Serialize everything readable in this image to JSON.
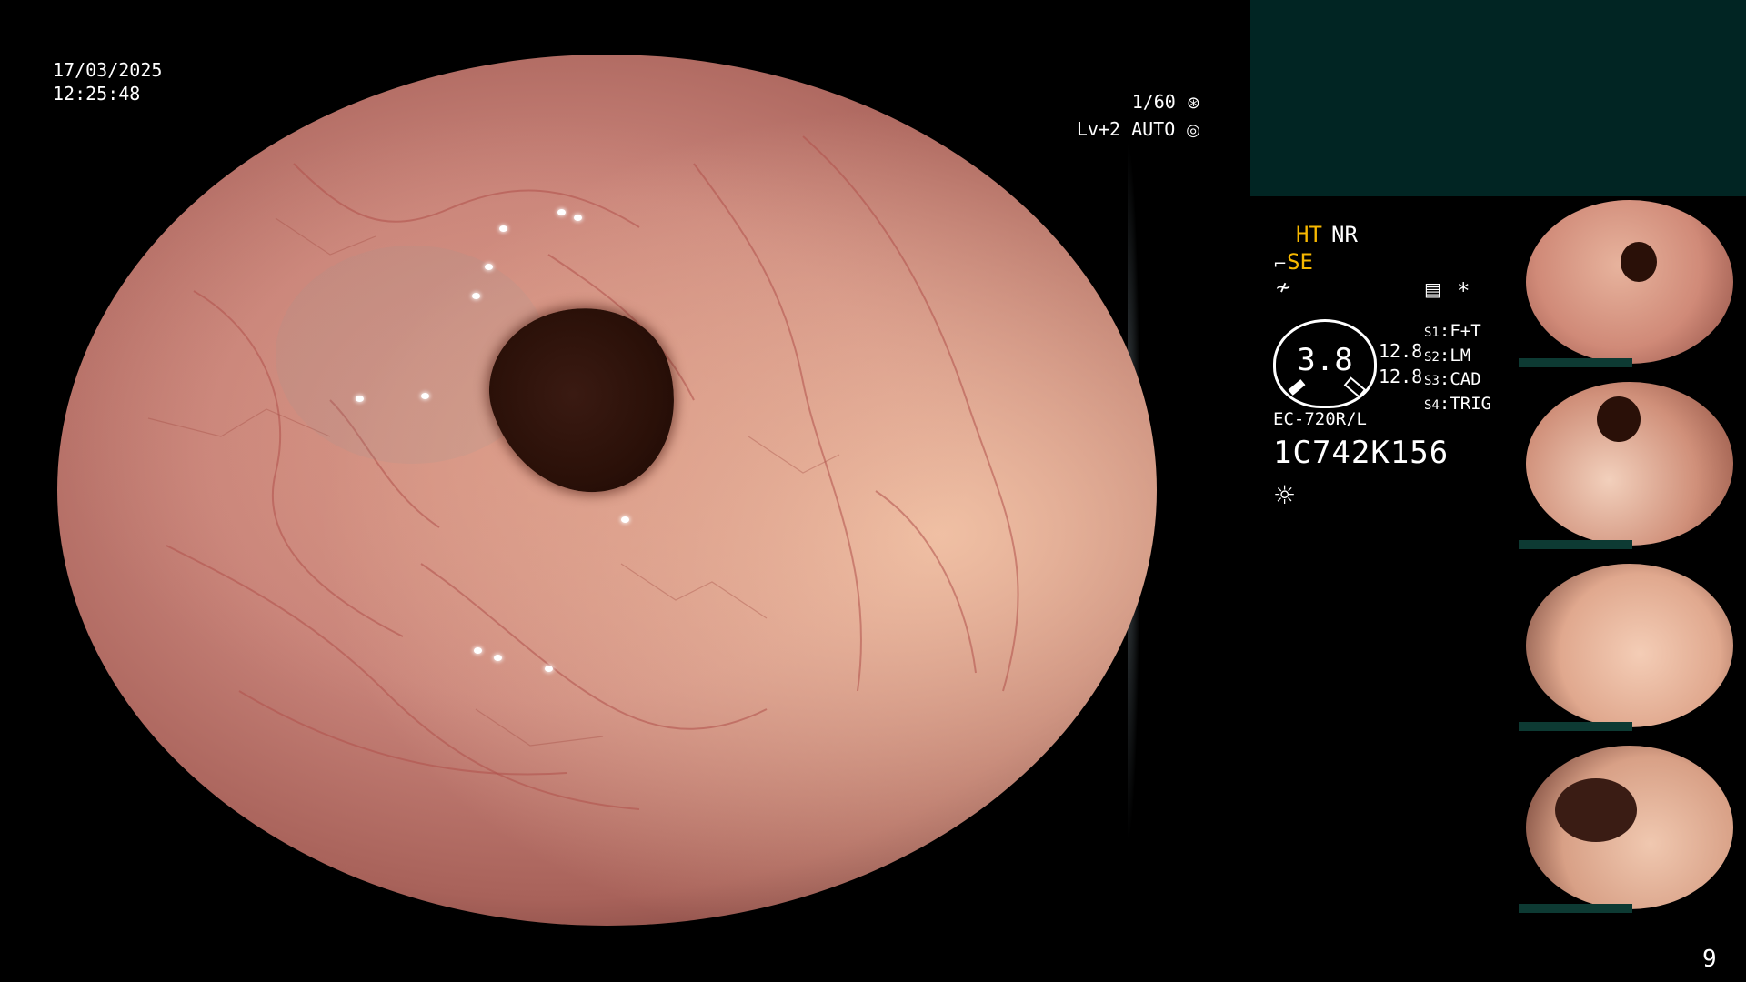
{
  "overlay": {
    "date": "17/03/2025",
    "time": "12:25:48",
    "shutter": "1/60",
    "shutter_icon": "aperture-icon",
    "level": "Lv+2 AUTO",
    "level_icon": "iris-icon"
  },
  "panel": {
    "ht": "HT",
    "nr": "NR",
    "se": "SE",
    "se_icon": "enhance-icon",
    "flat_icon": "color-tone-icon",
    "asterisk": "*",
    "doc_icon": "image-settings-icon",
    "gauge_value": "3.8",
    "scale_top": "12.8",
    "scale_bottom": "12.8",
    "settings": [
      {
        "key": "S1",
        "value": "F+T"
      },
      {
        "key": "S2",
        "value": "LM"
      },
      {
        "key": "S3",
        "value": "CAD"
      },
      {
        "key": "S4",
        "value": "TRIG"
      }
    ],
    "scope_model": "EC-720R/L",
    "scope_serial": "1C742K156",
    "light_icon": "light-source-icon"
  },
  "thumbnails": [
    {
      "name": "thumbnail-1",
      "tone": "#d99a86"
    },
    {
      "name": "thumbnail-2",
      "tone": "#d4957f"
    },
    {
      "name": "thumbnail-3",
      "tone": "#e6b59c"
    },
    {
      "name": "thumbnail-4",
      "tone": "#dba58c"
    }
  ],
  "page_number": "9",
  "colors": {
    "accent": "#f7b800",
    "panel_teal": "#012523",
    "mucosa": "#d9988a"
  }
}
